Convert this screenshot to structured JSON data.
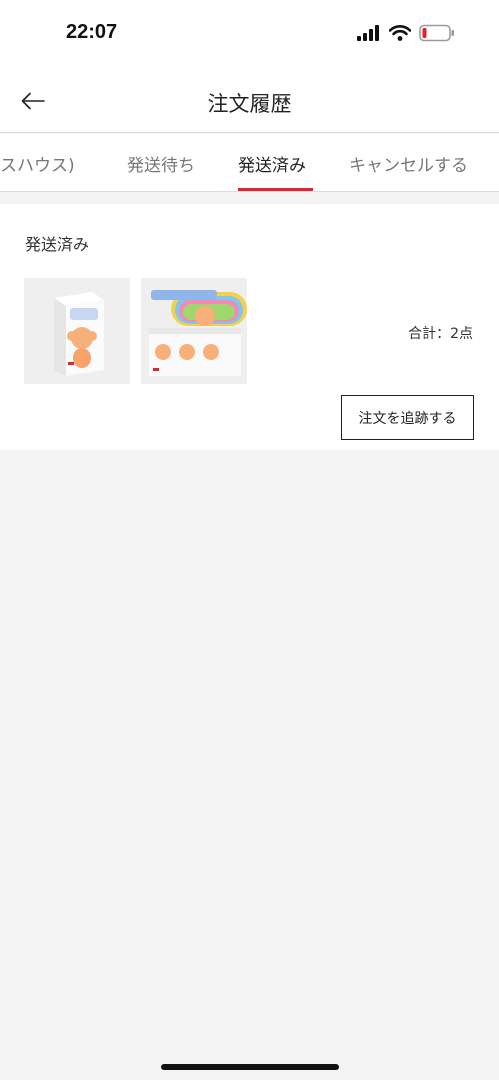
{
  "status_bar": {
    "time": "22:07",
    "icons": [
      "signal-icon",
      "wifi-icon",
      "battery-icon"
    ]
  },
  "header": {
    "back_icon": "back-arrow-icon",
    "title": "注文履歴"
  },
  "tabs": [
    {
      "label": "スハウス)",
      "active": false
    },
    {
      "label": "発送待ち",
      "active": false
    },
    {
      "label": "発送済み",
      "active": true
    },
    {
      "label": "キャンセルする",
      "active": false
    }
  ],
  "order": {
    "status": "発送済み",
    "total": "合計：2点",
    "track_button": "注文を追跡する"
  },
  "colors": {
    "accent": "#e0252e",
    "background": "#f3f3f3"
  }
}
